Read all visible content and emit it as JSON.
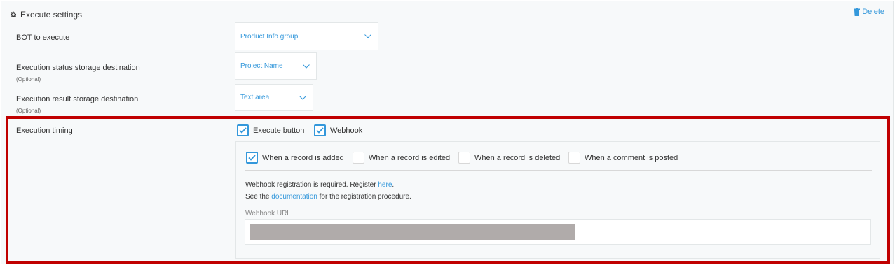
{
  "header": {
    "title": "Execute settings",
    "delete_label": "Delete",
    "gear_icon": "gear-icon",
    "trash_icon": "trash-icon"
  },
  "rows": {
    "bot": {
      "label": "BOT to execute",
      "value": "Product Info group"
    },
    "status_dest": {
      "label": "Execution status storage destination",
      "optional": "(Optional)",
      "value": "Project Name"
    },
    "result_dest": {
      "label": "Execution result storage destination",
      "optional": "(Optional)",
      "value": "Text area"
    },
    "timing": {
      "label": "Execution timing",
      "options": [
        {
          "label": "Execute button",
          "checked": true
        },
        {
          "label": "Webhook",
          "checked": true
        }
      ]
    }
  },
  "webhook": {
    "events": [
      {
        "label": "When a record is added",
        "checked": true
      },
      {
        "label": "When a record is edited",
        "checked": false
      },
      {
        "label": "When a record is deleted",
        "checked": false
      },
      {
        "label": "When a comment is posted",
        "checked": false
      }
    ],
    "line1_prefix": "Webhook registration is required. Register ",
    "line1_link": "here",
    "line1_suffix": ".",
    "line2_prefix": "See the ",
    "line2_link": "documentation",
    "line2_suffix": " for the registration procedure.",
    "url_label": "Webhook URL",
    "url_value": ""
  },
  "colors": {
    "accent": "#3498db",
    "highlight": "#c00000",
    "redaction": "#b0abaa"
  }
}
